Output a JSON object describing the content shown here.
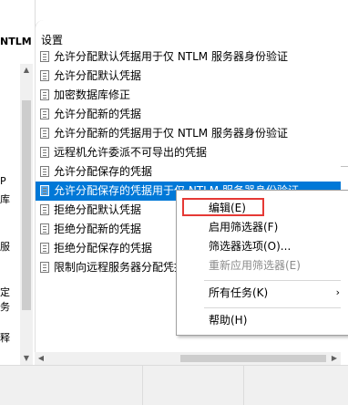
{
  "left_pane": {
    "title": "NTLM 服",
    "items": [
      "P",
      "库",
      "服",
      "定",
      "务",
      "释"
    ]
  },
  "main": {
    "column_header": "设置",
    "policies": [
      {
        "label": "允许分配默认凭据用于仅 NTLM 服务器身份验证",
        "selected": false
      },
      {
        "label": "允许分配默认凭据",
        "selected": false
      },
      {
        "label": "加密数据库修正",
        "selected": false
      },
      {
        "label": "允许分配新的凭据",
        "selected": false
      },
      {
        "label": "允许分配新的凭据用于仅 NTLM 服务器身份验证",
        "selected": false
      },
      {
        "label": "远程机允许委派不可导出的凭据",
        "selected": false
      },
      {
        "label": "允许分配保存的凭据",
        "selected": false
      },
      {
        "label": "允许分配保存的凭据用于仅 NTLM 服务器身份验证",
        "selected": true
      },
      {
        "label": "拒绝分配默认凭据",
        "selected": false
      },
      {
        "label": "拒绝分配新的凭据",
        "selected": false
      },
      {
        "label": "拒绝分配保存的凭据",
        "selected": false
      },
      {
        "label": "限制向远程服务器分配凭据",
        "selected": false
      }
    ]
  },
  "context_menu": {
    "edit": "编辑(E)",
    "enable_filter": "启用筛选器(F)",
    "filter_options": "筛选器选项(O)...",
    "reapply_filter": "重新应用筛选器(E)",
    "all_tasks": "所有任务(K)",
    "help": "帮助(H)"
  },
  "colors": {
    "selection": "#0078d7",
    "highlight_border": "#e53935"
  },
  "icons": {
    "policy": "policy-setting-icon",
    "submenu": "chevron-right-icon"
  }
}
